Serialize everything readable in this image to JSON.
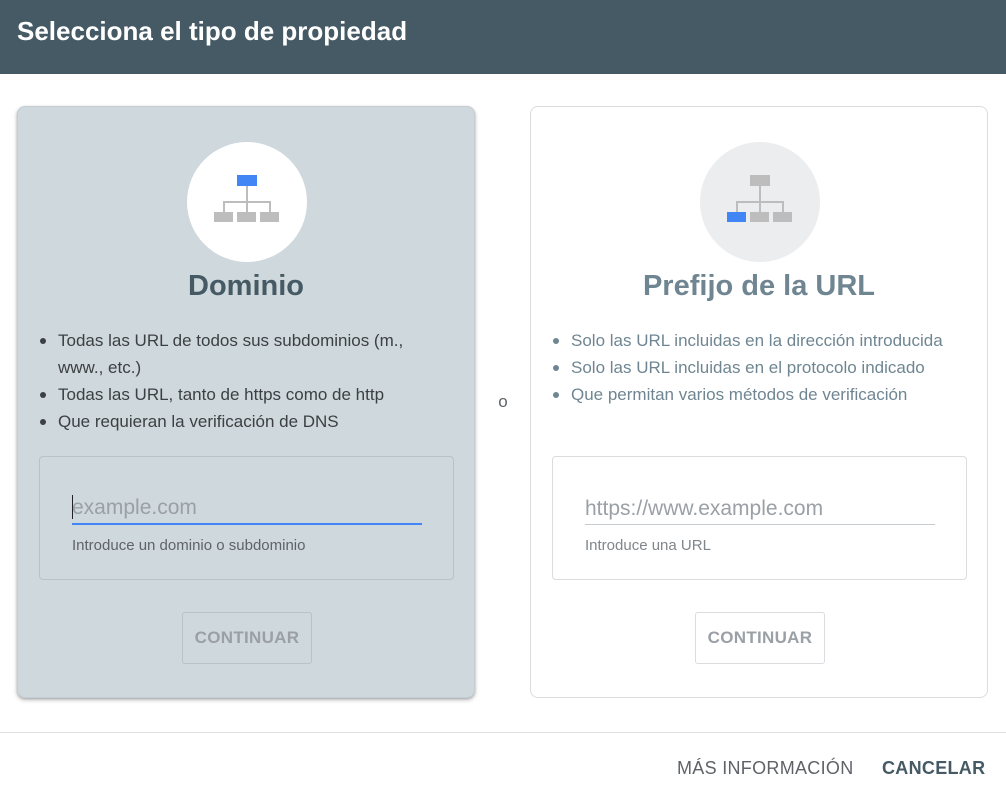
{
  "header": {
    "title": "Selecciona el tipo de propiedad"
  },
  "options": {
    "domain": {
      "title": "Dominio",
      "icon": "sitemap-icon",
      "bullets": [
        "Todas las URL de todos sus subdominios (m., www., etc.)",
        "Todas las URL, tanto de https como de http",
        "Que requieran la verificación de DNS"
      ],
      "input_value": "",
      "input_placeholder": "example.com",
      "helper": "Introduce un dominio o subdominio",
      "button": "CONTINUAR",
      "selected": true
    },
    "url_prefix": {
      "title": "Prefijo de la URL",
      "icon": "sitemap-icon",
      "bullets": [
        "Solo las URL incluidas en la dirección introducida",
        "Solo las URL incluidas en el protocolo indicado",
        "Que permitan varios métodos de verificación"
      ],
      "input_value": "",
      "input_placeholder": "https://www.example.com",
      "helper": "Introduce una URL",
      "button": "CONTINUAR",
      "selected": false
    }
  },
  "separator": "o",
  "footer": {
    "more_info": "MÁS INFORMACIÓN",
    "cancel": "CANCELAR"
  },
  "colors": {
    "header_bg": "#455a64",
    "selected_card_bg": "#cfd8dc",
    "accent_blue": "#4285f4",
    "icon_gray": "#bdbdbd"
  }
}
